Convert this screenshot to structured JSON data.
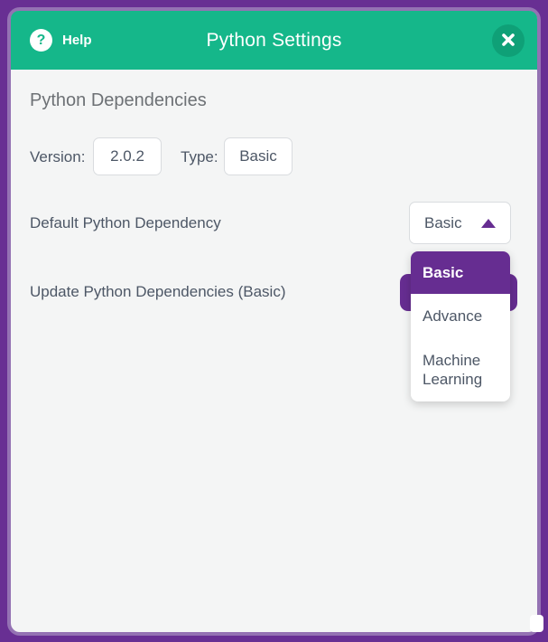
{
  "colors": {
    "frame_purple": "#682f93",
    "frame_border_purple": "#9472b3",
    "header_green": "#15b78a",
    "close_button_green": "#0fa077",
    "accent_purple": "#662d91",
    "body_bg": "#f4f5f5",
    "label_slate": "#4d5766",
    "heading_gray": "#6d7175"
  },
  "header": {
    "help_label": "Help",
    "help_icon_glyph": "?",
    "title": "Python Settings"
  },
  "settings": {
    "section_heading": "Python Dependencies",
    "version_label": "Version:",
    "version_value": "2.0.2",
    "type_label": "Type:",
    "type_value": "Basic",
    "default_dependency_label": "Default Python Dependency",
    "update_label": "Update Python Dependencies (Basic)"
  },
  "dropdown": {
    "selected_value": "Basic",
    "options": [
      "Basic",
      "Advance",
      "Machine Learning"
    ]
  }
}
